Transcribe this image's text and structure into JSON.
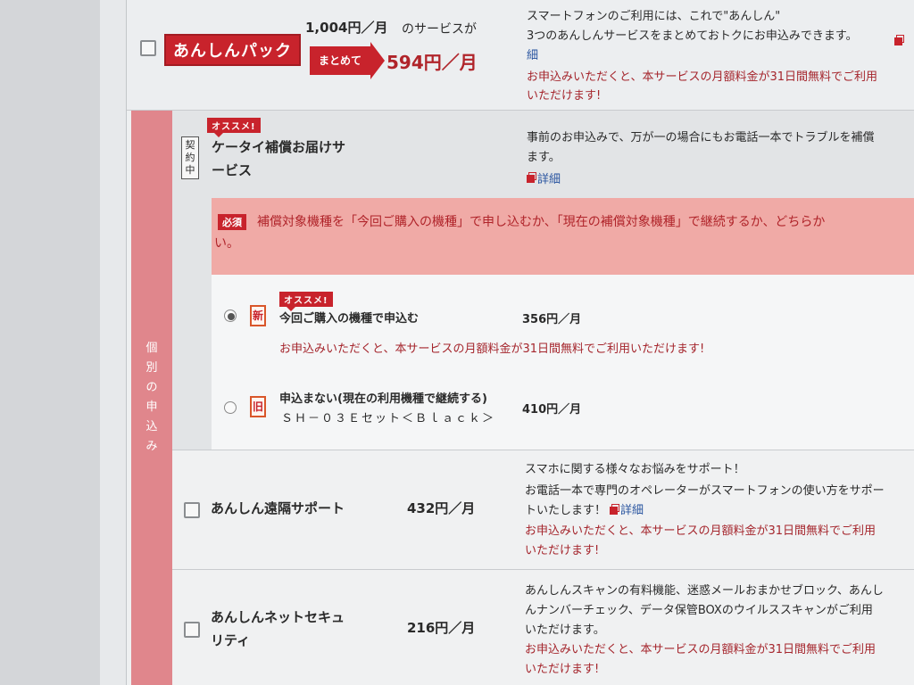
{
  "pack": {
    "logo": "あんしんパック",
    "orig_price": "1,004円／月",
    "orig_suffix": "のサービスが",
    "badge": "まとめて",
    "price": "594円／月",
    "desc1": "スマートフォンのご利用には、これで\"あんしん\"",
    "desc2": "3つのあんしんサービスをまとめておトクにお申込みできます。",
    "link_cont": "細",
    "promo1": "お申込みいただくと、本サービスの月額料金が31日間無料でご利用",
    "promo2": "いただけます!"
  },
  "sidebar": {
    "label": "個別の申込み"
  },
  "keitai": {
    "contract_badge": "契約中",
    "recommend": "オススメ!",
    "name_line1": "ケータイ補償お届けサ",
    "name_line2": "ービス",
    "desc1": "事前のお申込みで、万が一の場合にもお電話一本でトラブルを補償",
    "desc2": "ます。",
    "detail_link": "詳細"
  },
  "required": {
    "badge": "必須",
    "text1": "補償対象機種を「今回ご購入の機種」で申し込むか、「現在の補償対象機種」で継続するか、どちらか",
    "text2": "い。"
  },
  "options": [
    {
      "tag": "新",
      "recommend": "オススメ!",
      "label": "今回ご購入の機種で申込む",
      "price": "356円／月",
      "promo": "お申込みいただくと、本サービスの月額料金が31日間無料でご利用いただけます!",
      "selected": true
    },
    {
      "tag": "旧",
      "label": "申込まない(現在の利用機種で継続する)",
      "device": "ＳＨ－０３Ｅセット＜Ｂｌａｃｋ＞",
      "price": "410円／月",
      "selected": false
    }
  ],
  "remote": {
    "name": "あんしん遠隔サポート",
    "price": "432円／月",
    "desc1": "スマホに関する様々なお悩みをサポート！",
    "desc2": "お電話一本で専門のオペレーターがスマートフォンの使い方をサポー",
    "desc3": "トいたします！",
    "detail_link": "詳細",
    "promo1": "お申込みいただくと、本サービスの月額料金が31日間無料でご利用",
    "promo2": "いただけます!"
  },
  "security": {
    "name_line1": "あんしんネットセキュ",
    "name_line2": "リティ",
    "price": "216円／月",
    "desc1": "あんしんスキャンの有料機能、迷惑メールおまかせブロック、あんし",
    "desc2": "んナンバーチェック、データ保管BOXのウイルススキャンがご利用",
    "desc3": "いただけます。",
    "promo1": "お申込みいただくと、本サービスの月額料金が31日間無料でご利用",
    "promo2": "いただけます!"
  },
  "colors": {
    "accent": "#c8232c",
    "sidebar": "#e0868c",
    "required_bg": "#f0aaa6",
    "promo_text": "#a5262d"
  }
}
